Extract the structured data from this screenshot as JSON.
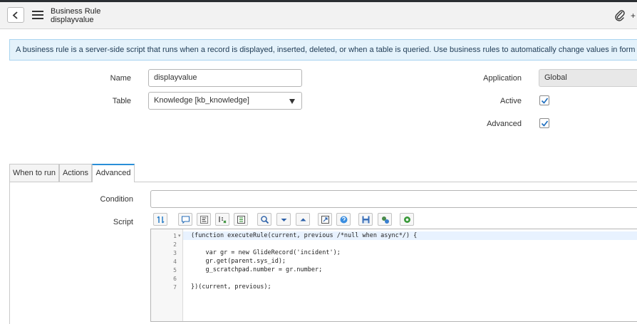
{
  "header": {
    "form_type": "Business Rule",
    "record_name": "displayvalue"
  },
  "info_message": "A business rule is a server-side script that runs when a record is displayed, inserted, deleted, or when a table is queried. Use business rules to automatically change values in form fields when the specified conditions are met.",
  "form": {
    "name_label": "Name",
    "name_value": "displayvalue",
    "table_label": "Table",
    "table_value": "Knowledge [kb_knowledge]",
    "application_label": "Application",
    "application_value": "Global",
    "active_label": "Active",
    "active_checked": true,
    "advanced_label": "Advanced",
    "advanced_checked": true
  },
  "tabs": [
    {
      "label": "When to run",
      "active": false
    },
    {
      "label": "Actions",
      "active": false
    },
    {
      "label": "Advanced",
      "active": true
    }
  ],
  "advanced": {
    "condition_label": "Condition",
    "condition_value": "",
    "script_label": "Script",
    "toolbar_icons": [
      "toggle-syntax-icon",
      "comment-icon",
      "format-code-icon",
      "replace-icon",
      "replace-all-icon",
      "search-icon",
      "fold-down-icon",
      "fold-up-icon",
      "fullscreen-icon",
      "help-icon",
      "save-icon",
      "debug-icon",
      "settings-icon"
    ],
    "line_numbers": [
      "1",
      "2",
      "3",
      "4",
      "5",
      "6",
      "7"
    ],
    "code_lines": [
      "(function executeRule(current, previous /*null when async*/) {",
      "",
      "    var gr = new GlideRecord('incident');",
      "    gr.get(parent.sys_id);",
      "    g_scratchpad.number = gr.number;",
      "",
      "})(current, previous);"
    ]
  }
}
